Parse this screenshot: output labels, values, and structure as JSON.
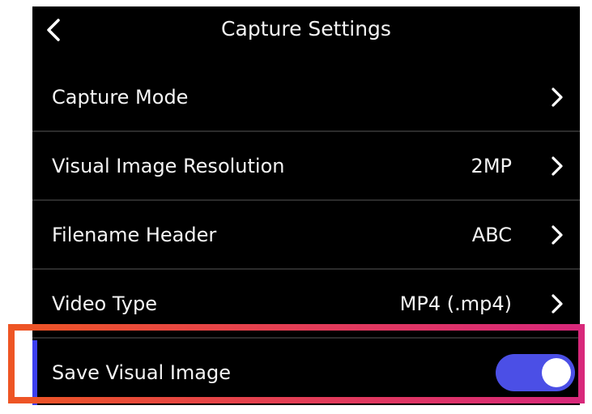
{
  "header": {
    "title": "Capture Settings",
    "back_icon": "chevron-left-icon"
  },
  "rows": [
    {
      "label": "Capture Mode",
      "value": "",
      "icon": "chevron-right-icon"
    },
    {
      "label": "Visual Image Resolution",
      "value": "2MP",
      "icon": "chevron-right-icon"
    },
    {
      "label": "Filename Header",
      "value": "ABC",
      "icon": "chevron-right-icon"
    },
    {
      "label": "Video Type",
      "value": "MP4 (.mp4)",
      "icon": "chevron-right-icon"
    }
  ],
  "save_visual_image": {
    "label": "Save Visual Image",
    "enabled": true,
    "toggle_color": "#4b4fe6"
  },
  "colors": {
    "background": "#000000",
    "accent": "#3c3ff0",
    "highlight": "#e6433f"
  }
}
